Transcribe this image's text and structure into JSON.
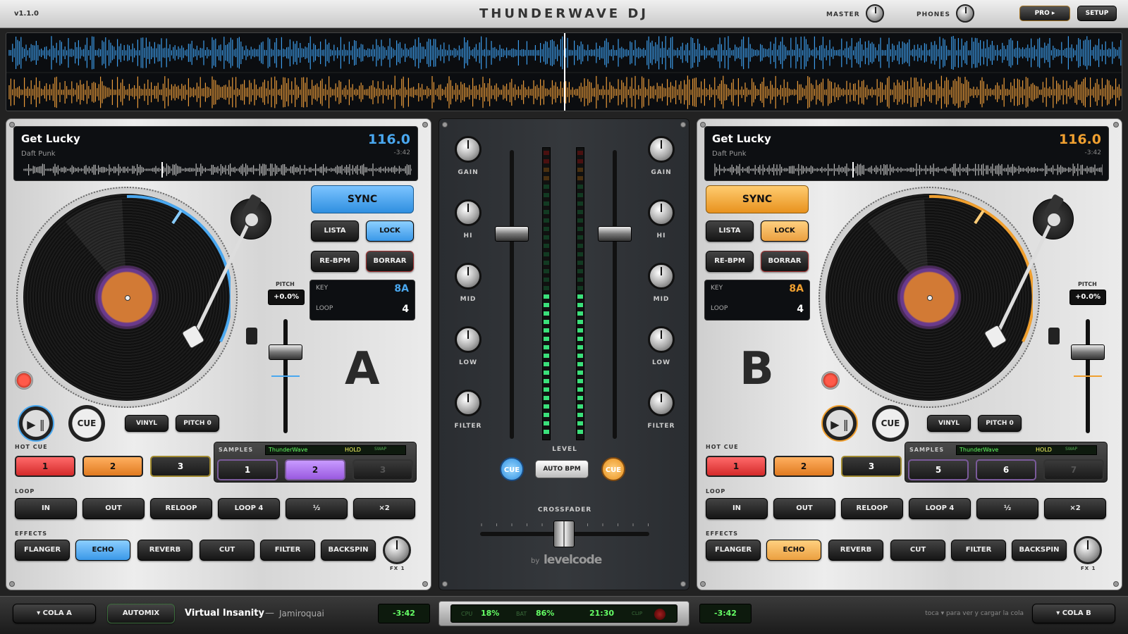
{
  "app": {
    "version": "v1.1.0",
    "title": "THUNDERWAVE DJ",
    "master_label": "MASTER",
    "phones_label": "PHONES",
    "pro_label": "PRO ▸",
    "setup_label": "SETUP"
  },
  "colors": {
    "deck_a": "#4aa8f0",
    "deck_b": "#f0a030",
    "wave_a": "#3d9be8",
    "wave_b": "#e89a3a"
  },
  "deck_a": {
    "title": "Get Lucky",
    "artist": "Daft Punk",
    "bpm": "116.0",
    "remaining": "-3:42",
    "sync": "SYNC",
    "lista": "LISTA",
    "lock": "LOCK",
    "rebpm": "RE-BPM",
    "borrar": "BORRAR",
    "key_label": "KEY",
    "key": "8A",
    "loop_label": "LOOP",
    "loop": "4",
    "pitch_label": "PITCH",
    "pitch": "+0.0%",
    "letter": "A",
    "play": "▶ ‖",
    "cue": "CUE",
    "vinyl": "VINYL",
    "pitch0": "PITCH 0",
    "hotcue_label": "HOT CUE",
    "hotcues": [
      "1",
      "2",
      "3"
    ],
    "samples_label": "SAMPLES",
    "samples_name": "ThunderWave",
    "hold": "HOLD",
    "swap": "SWAP",
    "sample_pads": [
      "1",
      "2",
      "3"
    ],
    "loop_section": "LOOP",
    "loop_buttons": [
      "IN",
      "OUT",
      "RELOOP",
      "LOOP 4",
      "½",
      "×2"
    ],
    "effects_label": "EFFECTS",
    "effects": [
      "FLANGER",
      "ECHO",
      "REVERB",
      "CUT",
      "FILTER",
      "BACKSPIN"
    ],
    "fx_label": "FX 1"
  },
  "deck_b": {
    "title": "Get Lucky",
    "artist": "Daft Punk",
    "bpm": "116.0",
    "remaining": "-3:42",
    "sync": "SYNC",
    "lista": "LISTA",
    "lock": "LOCK",
    "rebpm": "RE-BPM",
    "borrar": "BORRAR",
    "key_label": "KEY",
    "key": "8A",
    "loop_label": "LOOP",
    "loop": "4",
    "pitch_label": "PITCH",
    "pitch": "+0.0%",
    "letter": "B",
    "play": "▶ ‖",
    "cue": "CUE",
    "vinyl": "VINYL",
    "pitch0": "PITCH 0",
    "hotcue_label": "HOT CUE",
    "hotcues": [
      "1",
      "2",
      "3"
    ],
    "samples_label": "SAMPLES",
    "samples_name": "ThunderWave",
    "hold": "HOLD",
    "swap": "SWAP",
    "sample_pads": [
      "5",
      "6",
      "7"
    ],
    "loop_section": "LOOP",
    "loop_buttons": [
      "IN",
      "OUT",
      "RELOOP",
      "LOOP 4",
      "½",
      "×2"
    ],
    "effects_label": "EFFECTS",
    "effects": [
      "FLANGER",
      "ECHO",
      "REVERB",
      "CUT",
      "FILTER",
      "BACKSPIN"
    ],
    "fx_label": "FX 1"
  },
  "mixer": {
    "knobs": [
      "GAIN",
      "HI",
      "MID",
      "LOW",
      "FILTER"
    ],
    "level_label": "LEVEL",
    "cue_a": "CUE",
    "auto_bpm": "AUTO BPM",
    "cue_b": "CUE",
    "crossfader_label": "CROSSFADER",
    "brand_by": "by",
    "brand": "levelcode"
  },
  "bottom": {
    "queue_a": "▾ COLA A",
    "automix": "AUTOMIX",
    "next_title": "Virtual Insanity",
    "separator": "—",
    "next_artist": "Jamiroquai",
    "time_a": "-3:42",
    "cpu_label": "CPU",
    "cpu": "18%",
    "bat_label": "BAT",
    "bat": "86%",
    "clock": "21:30",
    "clip_label": "CLIP",
    "time_b": "-3:42",
    "hint": "toca ▾ para ver y cargar la cola",
    "queue_b": "▾ COLA B"
  }
}
